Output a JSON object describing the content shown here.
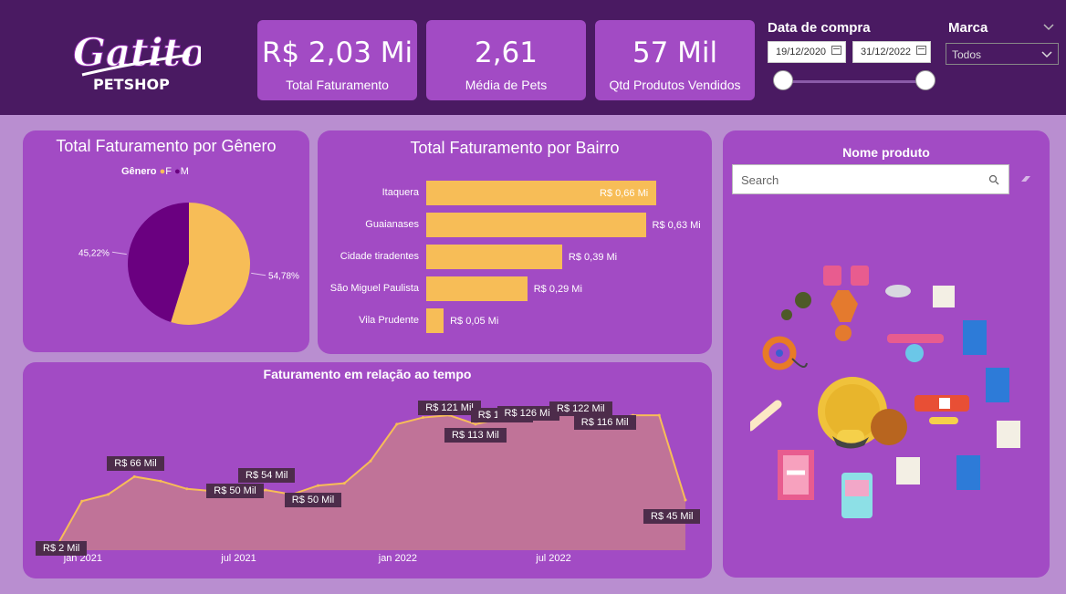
{
  "logo": {
    "text": "Gatito",
    "subtext": "PETSHOP"
  },
  "kpis": [
    {
      "value": "R$ 2,03 Mi",
      "label": "Total Faturamento"
    },
    {
      "value": "2,61",
      "label": "Média de Pets"
    },
    {
      "value": "57 Mil",
      "label": "Qtd Produtos Vendidos"
    }
  ],
  "date_filter": {
    "title": "Data de compra",
    "start": "19/12/2020",
    "end": "31/12/2022",
    "range_selected": [
      0,
      1
    ]
  },
  "brand_filter": {
    "title": "Marca",
    "value": "Todos"
  },
  "colors": {
    "header": "#4a1a62",
    "panel": "#a24bc4",
    "background": "#b98ed0",
    "accent_yellow": "#f7bd57",
    "accent_purple": "#6a0080",
    "area_fill": "#c57a90"
  },
  "gender_panel": {
    "title": "Total Faturamento por Gênero",
    "legend_title": "Gênero",
    "label_m": "45,22%",
    "label_f": "54,78%"
  },
  "bairro_panel": {
    "title": "Total Faturamento por Bairro"
  },
  "time_panel": {
    "title": "Faturamento em relação ao tempo"
  },
  "product_panel": {
    "title": "Nome produto",
    "search_placeholder": "Search",
    "search_icon": "search-icon",
    "eraser_icon": "eraser-icon"
  },
  "chart_data": [
    {
      "type": "pie",
      "title": "Total Faturamento por Gênero",
      "legend_title": "Gênero",
      "legend_position": "top",
      "slices": [
        {
          "name": "F",
          "value": 54.78,
          "label": "54,78%",
          "color": "#f7bd57"
        },
        {
          "name": "M",
          "value": 45.22,
          "label": "45,22%",
          "color": "#6a0080"
        }
      ]
    },
    {
      "type": "bar",
      "orientation": "horizontal",
      "title": "Total Faturamento por Bairro",
      "categories": [
        "Itaquera",
        "Guaianases",
        "Cidade tiradentes",
        "São Miguel Paulista",
        "Vila Prudente"
      ],
      "values": [
        0.66,
        0.63,
        0.39,
        0.29,
        0.05
      ],
      "data_labels": [
        "R$ 0,66 Mi",
        "R$ 0,63 Mi",
        "R$ 0,39 Mi",
        "R$ 0,29 Mi",
        "R$ 0,05 Mi"
      ],
      "xlim": [
        0,
        0.66
      ],
      "unit": "R$ Mi",
      "color": "#f7bd57"
    },
    {
      "type": "area",
      "title": "Faturamento em relação ao tempo",
      "x_ticks": [
        "jan 2021",
        "jul 2021",
        "jan 2022",
        "jul 2022"
      ],
      "x": [
        "2020-12",
        "2021-01",
        "2021-02",
        "2021-03",
        "2021-04",
        "2021-05",
        "2021-06",
        "2021-07",
        "2021-08",
        "2021-09",
        "2021-10",
        "2021-11",
        "2021-12",
        "2022-01",
        "2022-02",
        "2022-03",
        "2022-04",
        "2022-05",
        "2022-06",
        "2022-07",
        "2022-08",
        "2022-09",
        "2022-10",
        "2022-11",
        "2022-12"
      ],
      "values": [
        2,
        44,
        50,
        66,
        62,
        55,
        53,
        50,
        54,
        50,
        58,
        60,
        80,
        113,
        119,
        121,
        113,
        118,
        126,
        124,
        122,
        116,
        121,
        121,
        45
      ],
      "data_labels": [
        {
          "index": 0,
          "text": "R$ 2 Mil"
        },
        {
          "index": 3,
          "text": "R$ 66 Mil"
        },
        {
          "index": 7,
          "text": "R$ 50 Mil"
        },
        {
          "index": 8,
          "text": "R$ 54 Mil"
        },
        {
          "index": 9,
          "text": "R$ 50 Mil"
        },
        {
          "index": 15,
          "text": "R$ 121 Mil"
        },
        {
          "index": 16,
          "text": "R$ 113 Mil"
        },
        {
          "index": 17,
          "text": "R$ 118 Mil"
        },
        {
          "index": 18,
          "text": "R$ 126 Mil"
        },
        {
          "index": 20,
          "text": "R$ 122 Mil"
        },
        {
          "index": 21,
          "text": "R$ 116 Mil"
        },
        {
          "index": 24,
          "text": "R$ 45 Mil"
        }
      ],
      "unit": "R$ Mil",
      "line_color": "#f7bd57",
      "fill_color": "#c57a90"
    }
  ]
}
